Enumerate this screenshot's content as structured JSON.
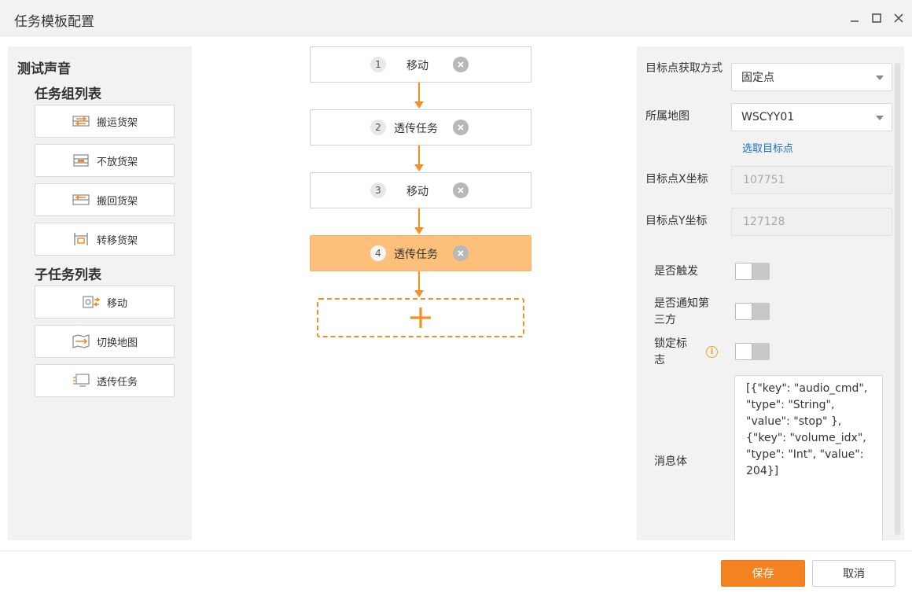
{
  "window": {
    "title": "任务模板配置"
  },
  "left_panel": {
    "scene_name": "测试声音",
    "task_group_title": "任务组列表",
    "task_groups": [
      {
        "label": "搬运货架",
        "icon": "shelf-move-icon"
      },
      {
        "label": "不放货架",
        "icon": "shelf-drop-icon"
      },
      {
        "label": "搬回货架",
        "icon": "shelf-return-icon"
      },
      {
        "label": "转移货架",
        "icon": "shelf-transfer-icon"
      }
    ],
    "subtask_title": "子任务列表",
    "subtasks": [
      {
        "label": "移动",
        "icon": "move-icon"
      },
      {
        "label": "切换地图",
        "icon": "map-switch-icon"
      },
      {
        "label": "透传任务",
        "icon": "passthrough-icon"
      }
    ]
  },
  "flow": {
    "nodes": [
      {
        "index": "1",
        "label": "移动"
      },
      {
        "index": "2",
        "label": "透传任务"
      },
      {
        "index": "3",
        "label": "移动"
      },
      {
        "index": "4",
        "label": "透传任务"
      }
    ],
    "active_index": 4
  },
  "form": {
    "target_method_label": "目标点获取方式",
    "target_method_value": "固定点",
    "map_label": "所属地图",
    "map_value": "WSCYY01",
    "select_target_link": "选取目标点",
    "x_label": "目标点X坐标",
    "x_value": "107751",
    "y_label": "目标点Y坐标",
    "y_value": "127128",
    "trigger_label": "是否触发",
    "trigger_on": false,
    "notify_label": "是否通知第三方",
    "notify_on": false,
    "lock_label": "锁定标志",
    "lock_on": false,
    "message_label": "消息体",
    "message_value": "[{\"key\": \"audio_cmd\", \"type\": \"String\", \"value\": \"stop\" }, {\"key\": \"volume_idx\", \"type\": \"Int\", \"value\": 204}]"
  },
  "footer": {
    "save_label": "保存",
    "cancel_label": "取消"
  },
  "colors": {
    "accent": "#f58220",
    "active_node": "#fcc07a",
    "link": "#1e6fd0"
  }
}
